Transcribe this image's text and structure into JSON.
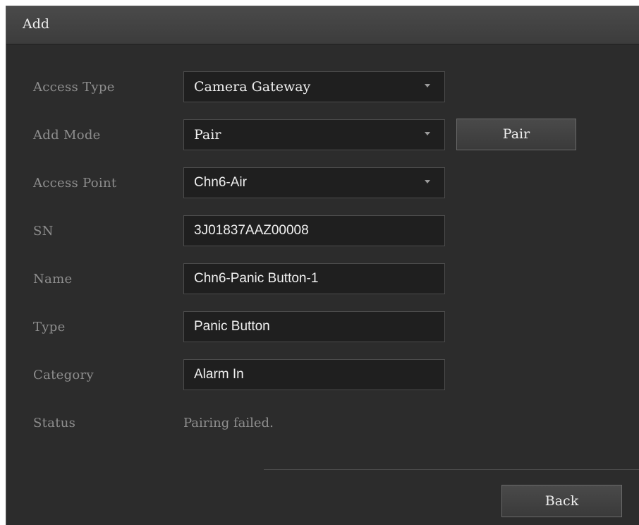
{
  "dialog": {
    "title": "Add"
  },
  "form": {
    "access_type": {
      "label": "Access Type",
      "value": "Camera Gateway"
    },
    "add_mode": {
      "label": "Add Mode",
      "value": "Pair",
      "button_label": "Pair"
    },
    "access_point": {
      "label": "Access Point",
      "value": "Chn6-Air"
    },
    "sn": {
      "label": "SN",
      "value": "3J01837AAZ00008"
    },
    "name": {
      "label": "Name",
      "value": "Chn6-Panic Button-1"
    },
    "type": {
      "label": "Type",
      "value": "Panic Button"
    },
    "category": {
      "label": "Category",
      "value": "Alarm In"
    },
    "status": {
      "label": "Status",
      "value": "Pairing failed."
    }
  },
  "footer": {
    "back_label": "Back"
  },
  "icons": {
    "dropdown": "chevron-down-icon"
  },
  "colors": {
    "background": "#2c2c2c",
    "field_background": "#1f1f1f",
    "label_text": "#8e8e8e",
    "value_text": "#f0f0f0"
  }
}
